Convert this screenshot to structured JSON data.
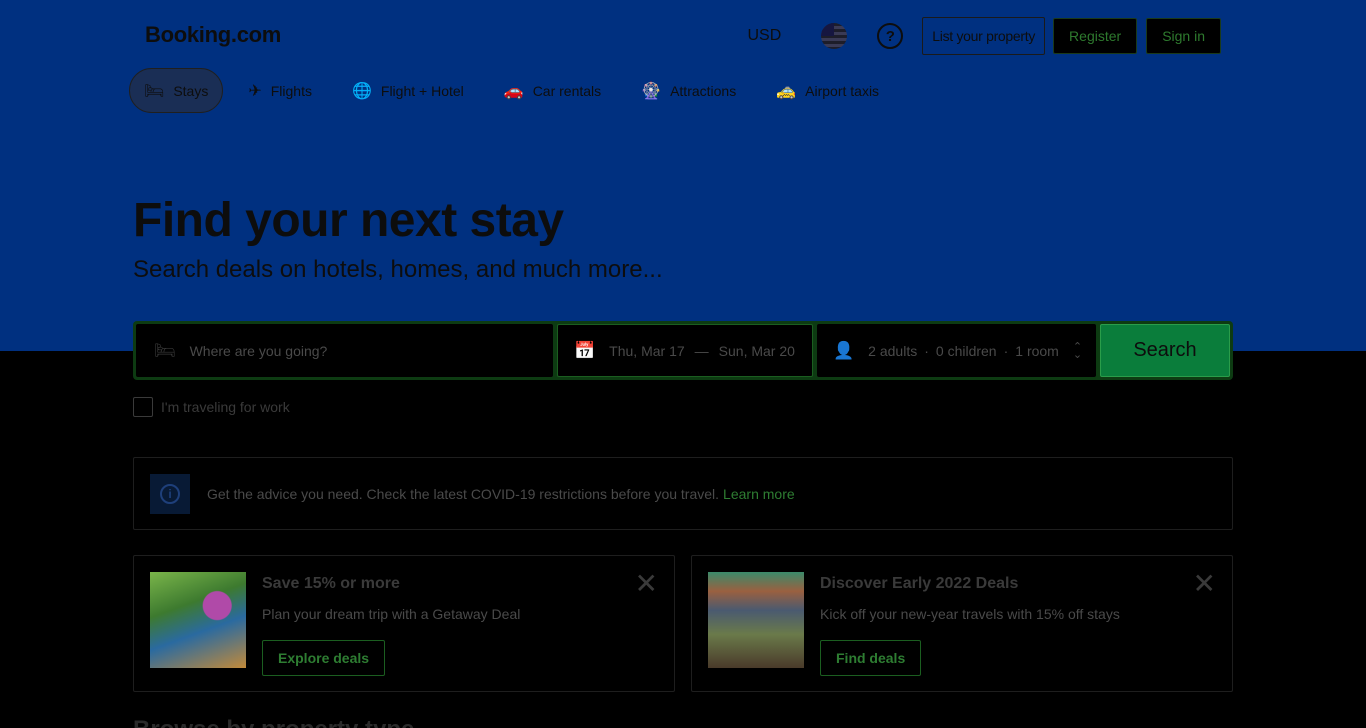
{
  "header": {
    "logo": "Booking.com",
    "currency": "USD",
    "help_icon": "?",
    "list_property": "List your property",
    "register": "Register",
    "sign_in": "Sign in"
  },
  "nav": {
    "items": [
      {
        "label": "Stays",
        "icon": "bed-icon",
        "glyph": "🛏"
      },
      {
        "label": "Flights",
        "icon": "plane-icon",
        "glyph": "✈"
      },
      {
        "label": "Flight + Hotel",
        "icon": "globe-icon",
        "glyph": "🌐"
      },
      {
        "label": "Car rentals",
        "icon": "car-icon",
        "glyph": "🚗"
      },
      {
        "label": "Attractions",
        "icon": "ferris-wheel-icon",
        "glyph": "🎡"
      },
      {
        "label": "Airport taxis",
        "icon": "taxi-icon",
        "glyph": "🚕"
      }
    ]
  },
  "hero": {
    "title": "Find your next stay",
    "subtitle": "Search deals on hotels, homes, and much more..."
  },
  "search": {
    "destination_placeholder": "Where are you going?",
    "check_in": "Thu, Mar 17",
    "dash": "—",
    "check_out": "Sun, Mar 20",
    "adults": "2 adults",
    "children": "0 children",
    "rooms": "1 room",
    "dot": "·",
    "button": "Search"
  },
  "work_travel": {
    "label": "I'm traveling for work"
  },
  "covid": {
    "info_icon": "i",
    "text": "Get the advice you need. Check the latest COVID-19 restrictions before you travel.",
    "link": "Learn more"
  },
  "cards": [
    {
      "title": "Save 15% or more",
      "subtitle": "Plan your dream trip with a Getaway Deal",
      "button": "Explore deals",
      "close": "✕"
    },
    {
      "title": "Discover Early 2022 Deals",
      "subtitle": "Kick off your new-year travels with 15% off stays",
      "button": "Find deals",
      "close": "✕"
    }
  ],
  "bottom": {
    "heading": "Browse by property type"
  },
  "colors": {
    "hero_bg": "#003080",
    "search_button": "#0a7d3b",
    "link_green": "#2e7d32"
  }
}
